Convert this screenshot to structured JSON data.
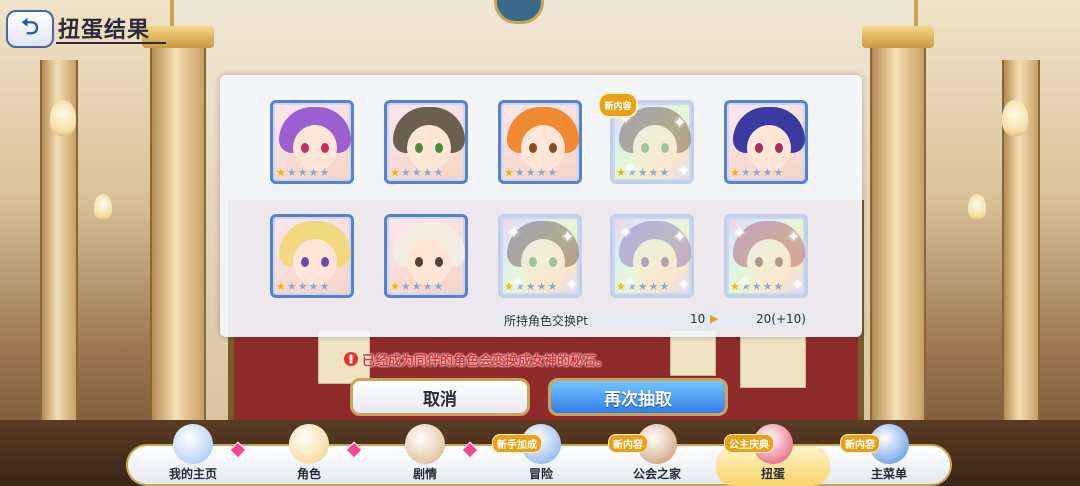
{
  "header": {
    "title": "扭蛋结果",
    "back_label": "⮌"
  },
  "results": [
    {
      "new": false,
      "stars": 1,
      "rainbow": false,
      "hair": "#9b5fd0",
      "eye": "#c0306a"
    },
    {
      "new": false,
      "stars": 1,
      "rainbow": false,
      "hair": "#6a6050",
      "eye": "#4a8a3a"
    },
    {
      "new": false,
      "stars": 1,
      "rainbow": false,
      "hair": "#f08a30",
      "eye": "#8a4a20"
    },
    {
      "new": true,
      "stars": 1,
      "rainbow": true,
      "hair": "#6a5040",
      "eye": "#4a8a5a"
    },
    {
      "new": false,
      "stars": 1,
      "rainbow": false,
      "hair": "#3a3aa0",
      "eye": "#a0305a"
    },
    {
      "new": false,
      "stars": 1,
      "rainbow": false,
      "hair": "#f2d880",
      "eye": "#6a4ab0"
    },
    {
      "new": false,
      "stars": 1,
      "rainbow": false,
      "hair": "#f4ece0",
      "eye": "#5a4030"
    },
    {
      "new": false,
      "stars": 1,
      "rainbow": true,
      "hair": "#6a5040",
      "eye": "#4a8a5a"
    },
    {
      "new": false,
      "stars": 1,
      "rainbow": true,
      "hair": "#8a6ab0",
      "eye": "#6a4a8a"
    },
    {
      "new": false,
      "stars": 1,
      "rainbow": true,
      "hair": "#b05060",
      "eye": "#6a3040"
    }
  ],
  "new_badge": "新内容",
  "exchange": {
    "label": "所持角色交换Pt",
    "before": "10",
    "arrow": "▶",
    "after": "20(+10)"
  },
  "warning": {
    "icon": "!",
    "text": "已经成为同伴的角色会变换成女神的秘石。"
  },
  "buttons": {
    "cancel": "取消",
    "again": "再次抽取"
  },
  "nav": [
    {
      "label": "我的主页",
      "icon": "castle-icon",
      "dot": true,
      "tag": "",
      "active": false,
      "color": "#9ec0f0"
    },
    {
      "label": "角色",
      "icon": "character-icon",
      "dot": true,
      "tag": "",
      "active": false,
      "color": "#f4d080"
    },
    {
      "label": "剧情",
      "icon": "scroll-icon",
      "dot": true,
      "tag": "",
      "active": false,
      "color": "#d8b080"
    },
    {
      "label": "冒险",
      "icon": "sword-icon",
      "dot": false,
      "tag": "新手加成",
      "active": false,
      "color": "#7aa8e8"
    },
    {
      "label": "公会之家",
      "icon": "door-icon",
      "dot": false,
      "tag": "新内容",
      "active": false,
      "color": "#c89060"
    },
    {
      "label": "扭蛋",
      "icon": "gacha-icon",
      "dot": false,
      "tag": "公主庆典",
      "active": true,
      "color": "#e04a6a"
    },
    {
      "label": "主菜单",
      "icon": "crystal-icon",
      "dot": false,
      "tag": "新内容",
      "active": false,
      "color": "#4a8ae0"
    }
  ]
}
